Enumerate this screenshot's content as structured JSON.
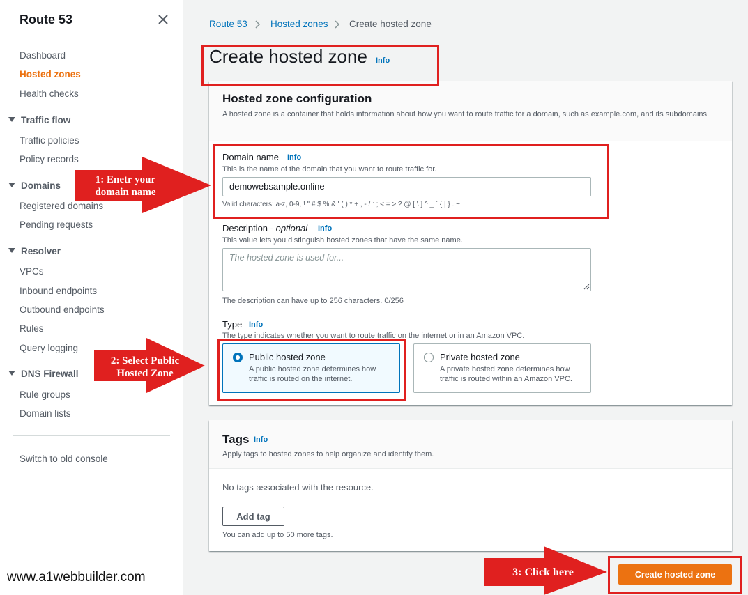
{
  "sidebar": {
    "title": "Route 53",
    "items": {
      "dashboard": "Dashboard",
      "hosted_zones": "Hosted zones",
      "health_checks": "Health checks",
      "traffic_flow": "Traffic flow",
      "traffic_policies": "Traffic policies",
      "policy_records": "Policy records",
      "domains": "Domains",
      "registered_domains": "Registered domains",
      "pending_requests": "Pending requests",
      "resolver": "Resolver",
      "vpcs": "VPCs",
      "inbound_endpoints": "Inbound endpoints",
      "outbound_endpoints": "Outbound endpoints",
      "rules": "Rules",
      "query_logging": "Query logging",
      "dns_firewall": "DNS Firewall",
      "rule_groups": "Rule groups",
      "domain_lists": "Domain lists",
      "switch_console": "Switch to old console"
    },
    "active_item": "hosted_zones"
  },
  "breadcrumb": {
    "root": "Route 53",
    "parent": "Hosted zones",
    "current": "Create hosted zone"
  },
  "page": {
    "title": "Create hosted zone",
    "info": "Info"
  },
  "config_panel": {
    "title": "Hosted zone configuration",
    "description": "A hosted zone is a container that holds information about how you want to route traffic for a domain, such as example.com, and its subdomains.",
    "domain_label": "Domain name",
    "domain_info": "Info",
    "domain_hint": "This is the name of the domain that you want to route traffic for.",
    "domain_value": "demowebsample.online",
    "domain_constraint": "Valid characters: a-z, 0-9, ! \" # $ % & ' ( ) * + , - / : ; < = > ? @ [ \\ ] ^ _ ` { | } . ~",
    "description_label": "Description",
    "description_optional": "optional",
    "description_info": "Info",
    "description_hint": "This value lets you distinguish hosted zones that have the same name.",
    "description_placeholder": "The hosted zone is used for...",
    "description_constraint": "The description can have up to 256 characters. 0/256",
    "type_label": "Type",
    "type_info": "Info",
    "type_hint": "The type indicates whether you want to route traffic on the internet or in an Amazon VPC.",
    "public_title": "Public hosted zone",
    "public_desc": "A public hosted zone determines how traffic is routed on the internet.",
    "private_title": "Private hosted zone",
    "private_desc": "A private hosted zone determines how traffic is routed within an Amazon VPC.",
    "selected_type": "public"
  },
  "tags_panel": {
    "title": "Tags",
    "info": "Info",
    "description": "Apply tags to hosted zones to help organize and identify them.",
    "empty_text": "No tags associated with the resource.",
    "add_tag_label": "Add tag",
    "limit_text": "You can add up to 50 more tags."
  },
  "footer": {
    "create_label": "Create hosted zone"
  },
  "annotations": {
    "step1_line1": "1: Enetr your",
    "step1_line2": "domain name",
    "step2_line1": "2: Select Public",
    "step2_line2": "Hosted Zone",
    "step3": "3: Click here",
    "watermark": "www.a1webbuilder.com"
  },
  "colors": {
    "accent": "#ec7211",
    "link": "#0073bb",
    "annotation": "#e0201f"
  }
}
